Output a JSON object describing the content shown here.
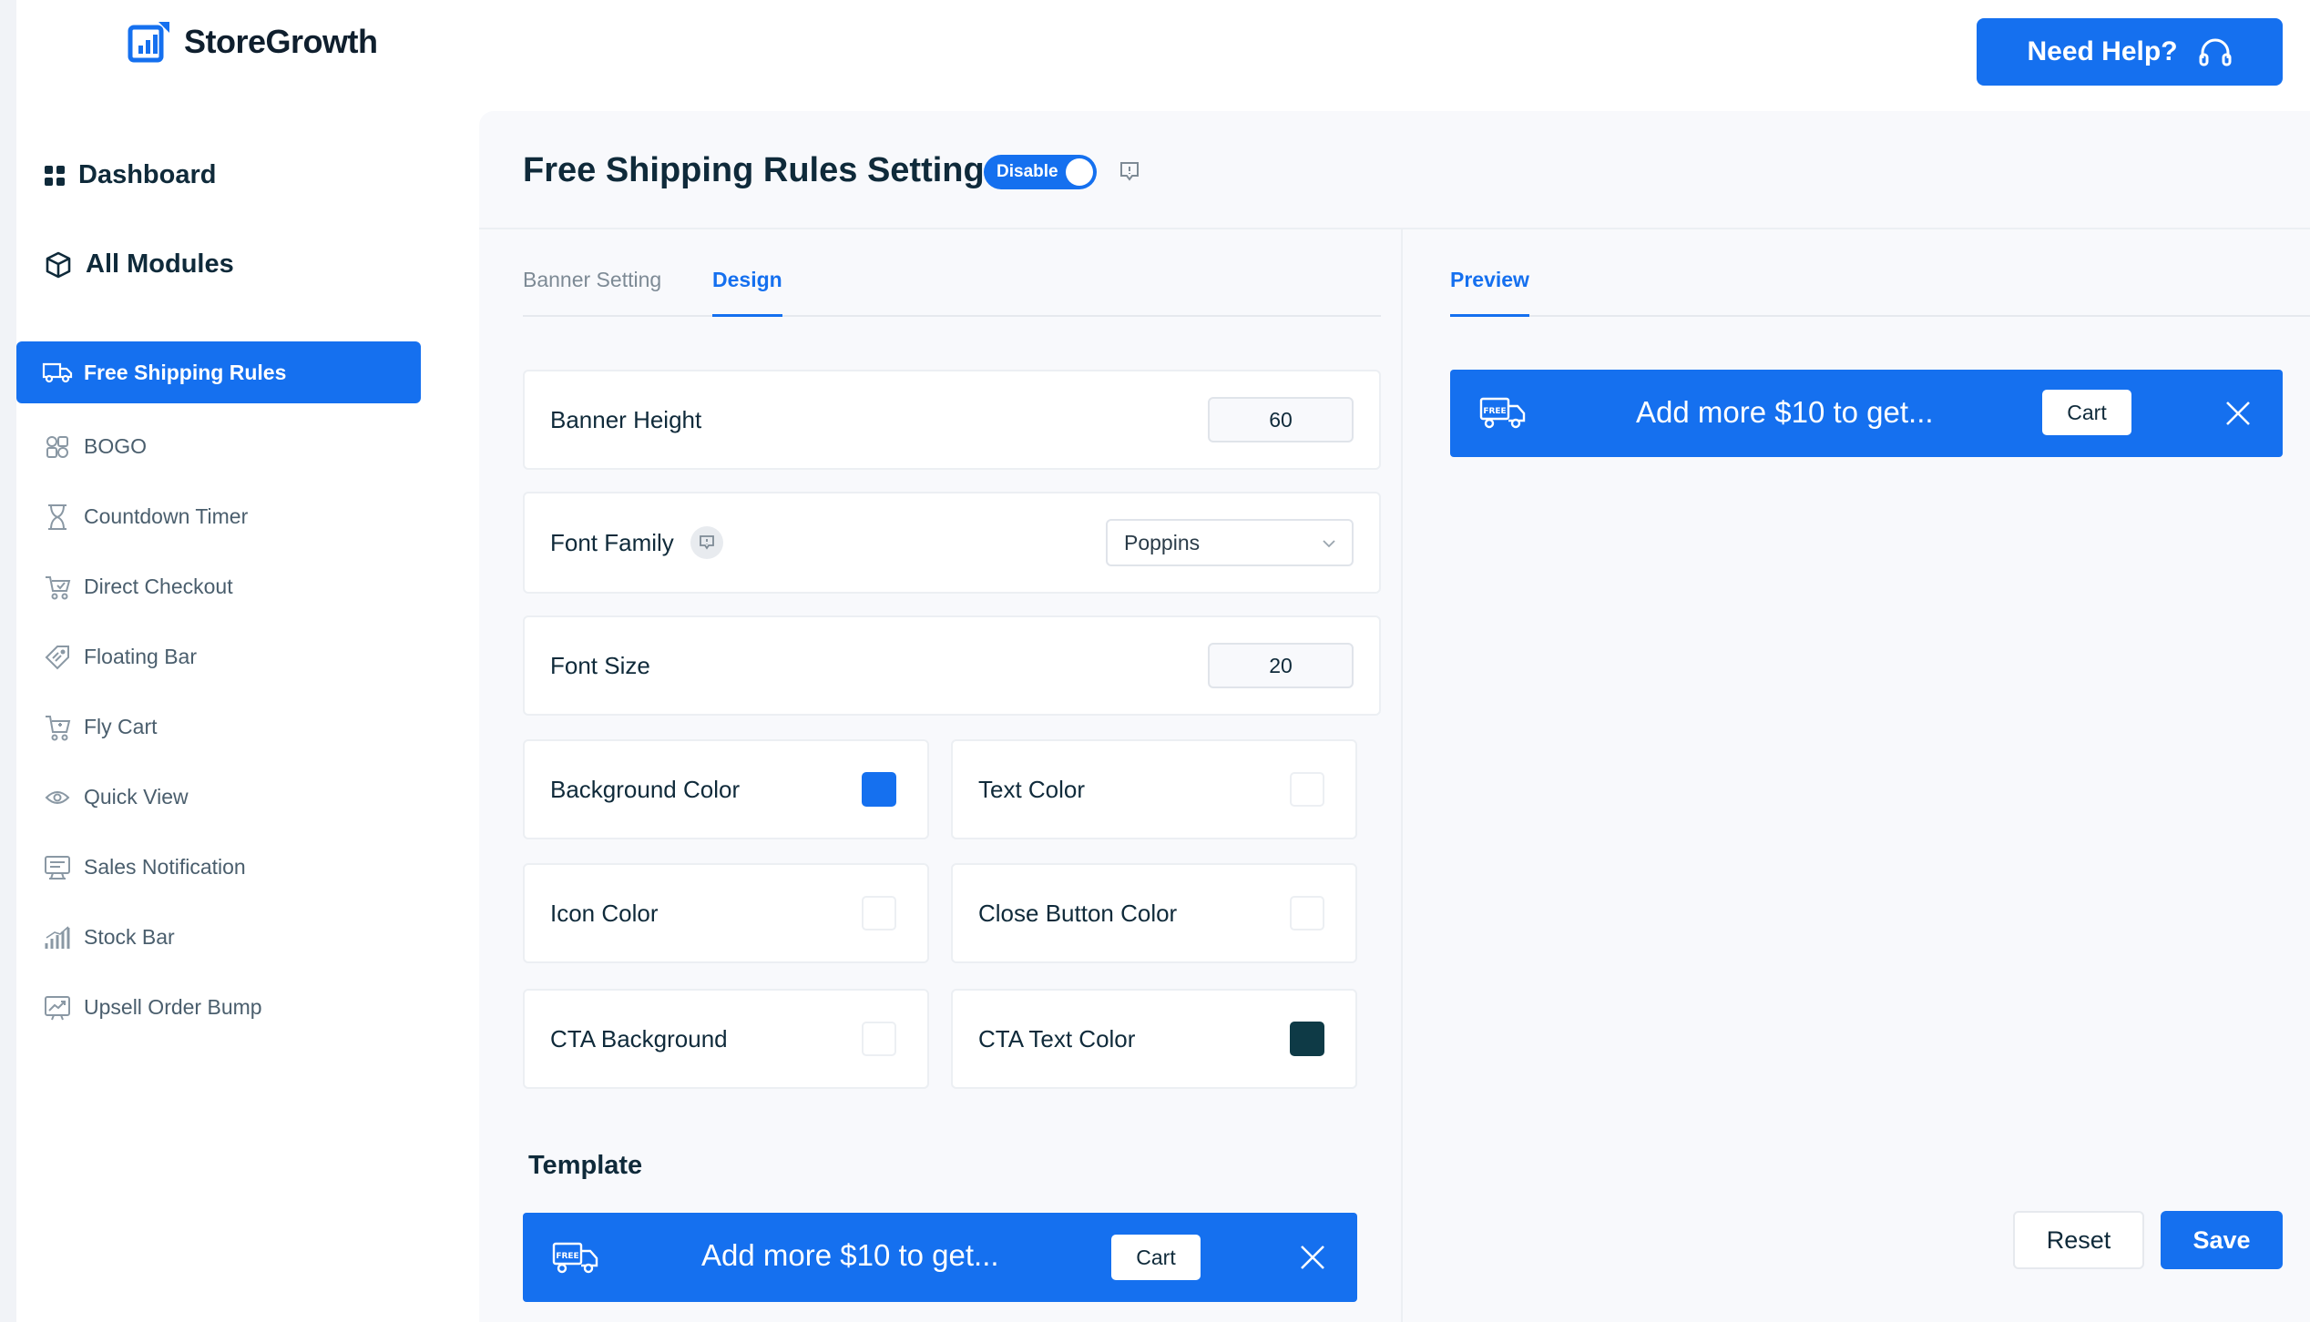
{
  "header": {
    "brand": "StoreGrowth",
    "help_label": "Need Help?"
  },
  "sidebar": {
    "dashboard": "Dashboard",
    "all_modules": "All Modules",
    "items": [
      {
        "label": "Free Shipping Rules",
        "icon": "truck-icon",
        "active": true
      },
      {
        "label": "BOGO",
        "icon": "bogo-icon"
      },
      {
        "label": "Countdown Timer",
        "icon": "hourglass-icon"
      },
      {
        "label": "Direct Checkout",
        "icon": "cart-checkout-icon"
      },
      {
        "label": "Floating Bar",
        "icon": "tag-icon"
      },
      {
        "label": "Fly Cart",
        "icon": "fly-cart-icon"
      },
      {
        "label": "Quick View",
        "icon": "eye-icon"
      },
      {
        "label": "Sales Notification",
        "icon": "notification-icon"
      },
      {
        "label": "Stock Bar",
        "icon": "bar-chart-icon"
      },
      {
        "label": "Upsell Order Bump",
        "icon": "trend-up-icon"
      }
    ]
  },
  "main": {
    "title": "Free Shipping Rules Setting",
    "toggle_label": "Disable",
    "tabs": [
      "Banner Setting",
      "Design"
    ],
    "active_tab": "Design",
    "fields": {
      "banner_height": {
        "label": "Banner Height",
        "value": "60"
      },
      "font_family": {
        "label": "Font Family",
        "value": "Poppins"
      },
      "font_size": {
        "label": "Font Size",
        "value": "20"
      },
      "background_color": {
        "label": "Background Color",
        "color": "#1570ef"
      },
      "text_color": {
        "label": "Text Color",
        "color": "#ffffff"
      },
      "icon_color": {
        "label": "Icon Color",
        "color": "#ffffff"
      },
      "close_button_color": {
        "label": "Close Button Color",
        "color": "#ffffff"
      },
      "cta_background": {
        "label": "CTA Background",
        "color": "#ffffff"
      },
      "cta_text_color": {
        "label": "CTA Text Color",
        "color": "#0e3a46"
      }
    },
    "template_title": "Template",
    "banner": {
      "text": "Add more $10 to get...",
      "cta": "Cart",
      "badge": "FREE"
    }
  },
  "preview": {
    "tab": "Preview",
    "banner_text": "Add more $10 to get...",
    "cta": "Cart"
  },
  "actions": {
    "reset": "Reset",
    "save": "Save"
  },
  "colors": {
    "accent": "#1570ef",
    "text_dark": "#0f2a3a"
  }
}
